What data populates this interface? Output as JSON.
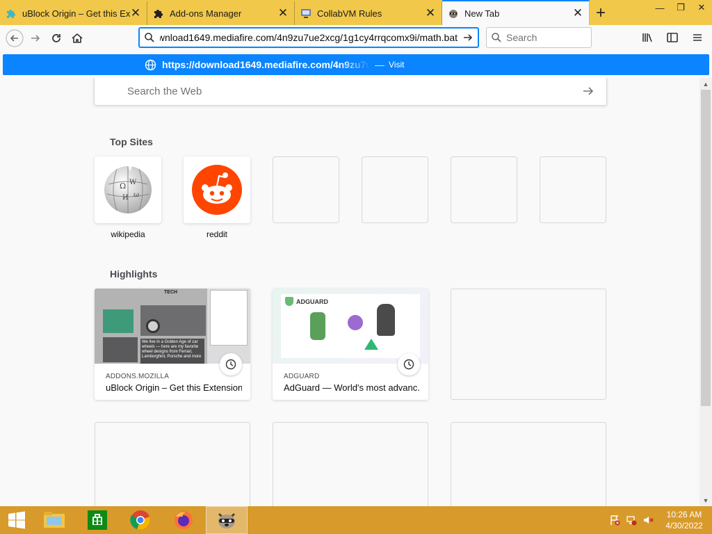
{
  "tabs": [
    {
      "title": "uBlock Origin – Get this Exte",
      "icon": "ublock-puzzle-icon"
    },
    {
      "title": "Add-ons Manager",
      "icon": "puzzle-icon"
    },
    {
      "title": "CollabVM Rules",
      "icon": "collabvm-icon"
    },
    {
      "title": "New Tab",
      "icon": "raccoon-icon",
      "active": true
    }
  ],
  "navbar": {
    "url": "wnload1649.mediafire.com/4n9zu7ue2xcg/1g1cy4rrqcomx9i/math.bat",
    "search_placeholder": "Search"
  },
  "suggestion": {
    "url": "https://download1649.mediafire.com/4n9zu7uc",
    "separator": "—",
    "action": "Visit"
  },
  "newtab": {
    "search_placeholder": "Search the Web",
    "top_sites_title": "Top Sites",
    "top_sites": [
      {
        "label": "wikipedia",
        "icon": "wikipedia-globe-icon"
      },
      {
        "label": "reddit",
        "icon": "reddit-alien-icon"
      },
      {
        "label": ""
      },
      {
        "label": ""
      },
      {
        "label": ""
      },
      {
        "label": ""
      }
    ],
    "highlights_title": "Highlights",
    "highlights": [
      {
        "host": "ADDONS.MOZILLA",
        "title": "uBlock Origin – Get this Extension ...",
        "thumb_header": "TECH",
        "thumb_caption": "We live in a Golden Age of car wheels — here are my favorite wheel designs from Ferrari, Lamborghini, Porsche and more"
      },
      {
        "host": "ADGUARD",
        "title": "AdGuard — World's most advanc...",
        "thumb_header": "ADGUARD"
      }
    ]
  },
  "taskbar": {
    "apps": [
      "explorer-icon",
      "store-icon",
      "chrome-icon",
      "firefox-icon",
      "raccoon-icon"
    ],
    "time": "10:26 AM",
    "date": "4/30/2022"
  },
  "colors": {
    "tabbar": "#f1c84a",
    "accent": "#0a84ff",
    "taskbar": "#d89a2a",
    "reddit": "#ff4500"
  }
}
